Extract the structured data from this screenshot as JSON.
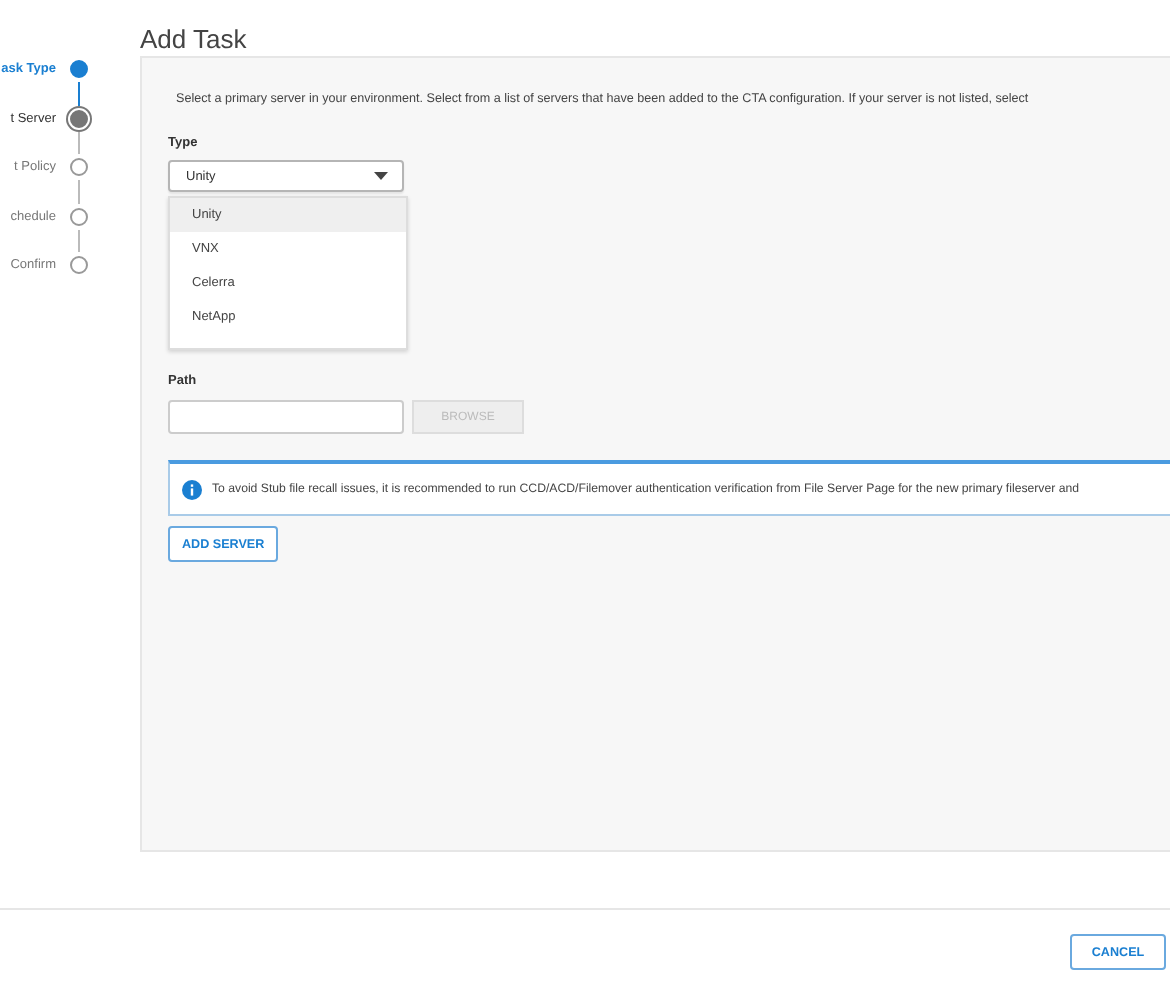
{
  "title": "Add Task",
  "steps": [
    {
      "label": "ask Type",
      "completed": true,
      "selected": false
    },
    {
      "label": "t Server",
      "completed": false,
      "selected": true
    },
    {
      "label": "t Policy",
      "completed": false,
      "selected": false
    },
    {
      "label": "chedule",
      "completed": false,
      "selected": false
    },
    {
      "label": "Confirm",
      "completed": false,
      "selected": false
    }
  ],
  "intro": "Select a primary server in your environment. Select from a list of servers that have been added to the CTA configuration. If your server is not listed, select",
  "type_field": {
    "label": "Type",
    "value": "Unity",
    "expanded": true,
    "options": [
      {
        "label": "Unity",
        "selected": true
      },
      {
        "label": "VNX",
        "selected": false
      },
      {
        "label": "Celerra",
        "selected": false
      },
      {
        "label": "NetApp",
        "selected": false
      }
    ]
  },
  "path_field": {
    "label": "Path",
    "browse": "BROWSE"
  },
  "info": "To avoid Stub file recall issues, it is recommended to run CCD/ACD/Filemover authentication verification from File Server Page for the new primary fileserver and",
  "add_button": "ADD SERVER",
  "cancel_button": "CANCEL"
}
